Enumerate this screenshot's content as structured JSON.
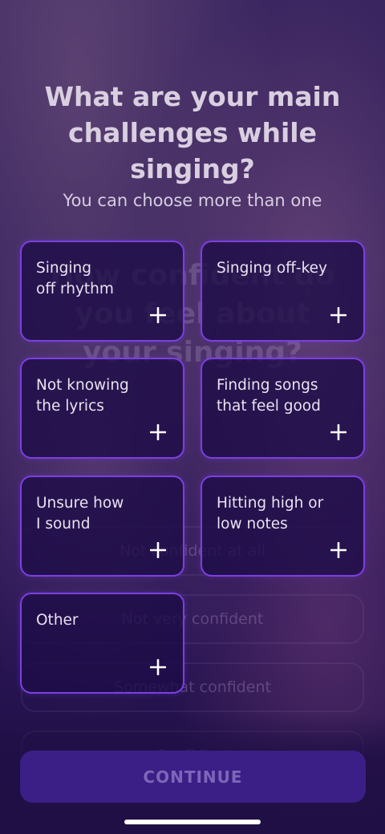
{
  "header": {
    "title": "What are your main challenges while singing?",
    "subtitle": "You can choose more than one"
  },
  "options": [
    {
      "label": "Singing\noff rhythm",
      "icon": "plus-icon"
    },
    {
      "label": "Singing off-key",
      "icon": "plus-icon"
    },
    {
      "label": "Not knowing\nthe lyrics",
      "icon": "plus-icon"
    },
    {
      "label": "Finding songs\nthat feel good",
      "icon": "plus-icon"
    },
    {
      "label": "Unsure how\nI sound",
      "icon": "plus-icon"
    },
    {
      "label": "Hitting high or\nlow notes",
      "icon": "plus-icon"
    },
    {
      "label": "Other",
      "icon": "plus-icon"
    }
  ],
  "background_ghost": {
    "title": "How confident do you feel about your singing?",
    "options": [
      "Not confident at all",
      "Not very confident",
      "Somewhat confident",
      "Confident"
    ]
  },
  "footer": {
    "continue_label": "CONTINUE"
  },
  "colors": {
    "card_border": "#7c3fe0",
    "button_bg": "#3b1f86",
    "button_text": "#7d66b8",
    "title_text": "#d9cfe0"
  }
}
